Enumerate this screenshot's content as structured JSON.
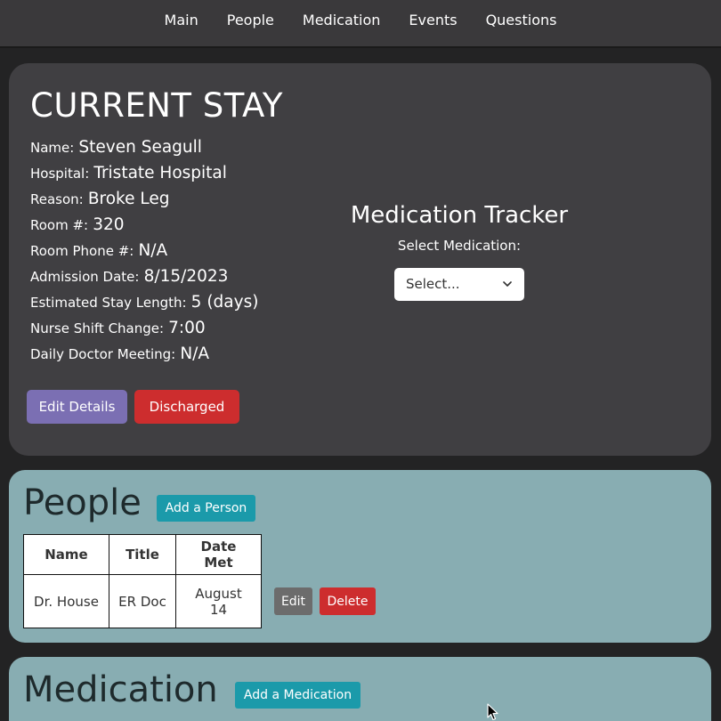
{
  "nav": {
    "items": [
      "Main",
      "People",
      "Medication",
      "Events",
      "Questions"
    ]
  },
  "stay": {
    "title": "CURRENT STAY",
    "details": [
      {
        "label": "Name:",
        "value": "Steven Seagull"
      },
      {
        "label": "Hospital:",
        "value": "Tristate Hospital"
      },
      {
        "label": "Reason:",
        "value": "Broke Leg"
      },
      {
        "label": "Room #:",
        "value": "320"
      },
      {
        "label": "Room Phone #:",
        "value": "N/A"
      },
      {
        "label": "Admission Date:",
        "value": "8/15/2023"
      },
      {
        "label": "Estimated Stay Length:",
        "value": "5 (days)"
      },
      {
        "label": "Nurse Shift Change:",
        "value": "7:00"
      },
      {
        "label": "Daily Doctor Meeting:",
        "value": "N/A"
      }
    ],
    "edit_label": "Edit Details",
    "discharged_label": "Discharged"
  },
  "tracker": {
    "title": "Medication Tracker",
    "select_label": "Select Medication:",
    "select_value": "Select..."
  },
  "people": {
    "title": "People",
    "add_label": "Add a Person",
    "headers": [
      "Name",
      "Title",
      "Date Met"
    ],
    "rows": [
      {
        "name": "Dr. House",
        "title": "ER Doc",
        "date": "August 14"
      }
    ],
    "edit_label": "Edit",
    "delete_label": "Delete"
  },
  "medication": {
    "title": "Medication",
    "add_label": "Add a Medication"
  },
  "colors": {
    "nav_bg": "#3a393b",
    "card_bg": "#403f42",
    "teal_bg": "#88adb2",
    "edit_purple": "#7b6fb3",
    "danger_red": "#cd2d2e",
    "teal_button": "#1b9aaa"
  }
}
